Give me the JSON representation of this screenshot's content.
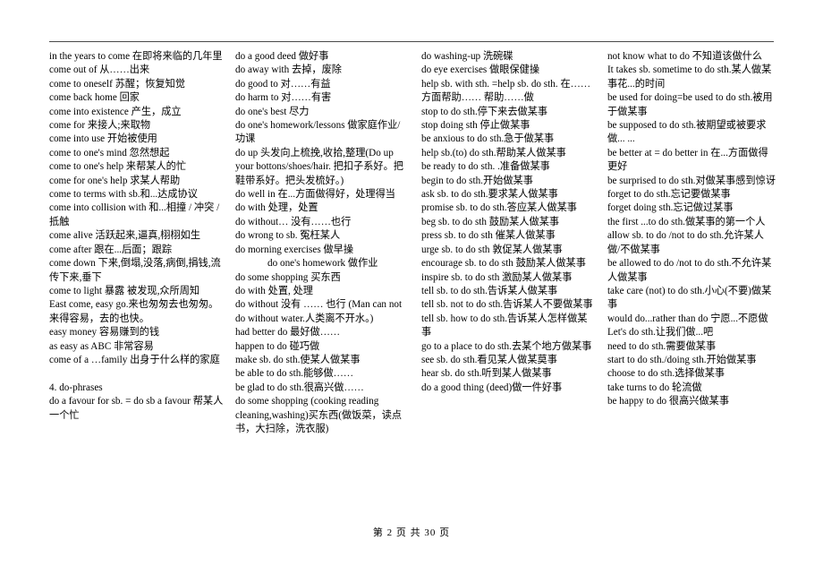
{
  "document": {
    "footer": "第 2 页 共 30 页"
  },
  "columns": [
    {
      "id": "column-1",
      "entries": [
        {
          "text": "in the years to come 在即将来临的几年里",
          "indent": false
        },
        {
          "text": "come out of 从……出来",
          "indent": false
        },
        {
          "text": "come to oneself 苏醒；恢复知觉",
          "indent": false
        },
        {
          "text": "come back home 回家",
          "indent": false
        },
        {
          "text": "come into existence 产生，成立",
          "indent": false
        },
        {
          "text": "come for 来接人;来取物",
          "indent": false
        },
        {
          "text": "come into use 开始被使用",
          "indent": false
        },
        {
          "text": "come to one's mind 忽然想起",
          "indent": false
        },
        {
          "text": "come to one's help 来帮某人的忙",
          "indent": false
        },
        {
          "text": "come for one's help 求某人帮助",
          "indent": false
        },
        {
          "text": "come to terms with sb.和...达成协议",
          "indent": false
        },
        {
          "text": "come into collision with 和...相撞 / 冲突 / 抵触",
          "indent": false
        },
        {
          "text": "come alive 活跃起来,逼真,栩栩如生",
          "indent": false
        },
        {
          "text": "come after 跟在...后面；跟踪",
          "indent": false
        },
        {
          "text": "come down 下来,倒塌,没落,病倒,捐钱,流传下来,垂下",
          "indent": false
        },
        {
          "text": "come to light 暴露 被发现,众所周知",
          "indent": false
        },
        {
          "text": "East come, easy go.来也匆匆去也匆匆。来得容易，去的也快。",
          "indent": false
        },
        {
          "text": "easy money 容易赚到的钱",
          "indent": false
        },
        {
          "text": "as easy as ABC 非常容易",
          "indent": false
        },
        {
          "text": "come of a …family 出身于什么样的家庭",
          "indent": false
        },
        {
          "text": "",
          "indent": false,
          "spacer": true
        },
        {
          "text": "4. do-phrases",
          "indent": false
        },
        {
          "text": "do a favour for sb. = do sb a favour 帮某人一个忙",
          "indent": false
        }
      ]
    },
    {
      "id": "column-2",
      "entries": [
        {
          "text": "do a good deed 做好事",
          "indent": false
        },
        {
          "text": "do away with 去掉，废除",
          "indent": false
        },
        {
          "text": "do good to 对……有益",
          "indent": false
        },
        {
          "text": "do harm to 对……有害",
          "indent": false
        },
        {
          "text": "do one's best 尽力",
          "indent": false
        },
        {
          "text": "do one's homework/lessons 做家庭作业/功课",
          "indent": false
        },
        {
          "text": "do up 头发向上梳挽,收拾,整理(Do up your bottons/shoes/hair. 把扣子系好。把鞋带系好。把头发梳好。)",
          "indent": false
        },
        {
          "text": "do well in 在...方面做得好，处理得当",
          "indent": false
        },
        {
          "text": "do with 处理，处置",
          "indent": false
        },
        {
          "text": "do without… 没有……也行",
          "indent": false
        },
        {
          "text": "do wrong to sb. 冤枉某人",
          "indent": false
        },
        {
          "text": "do morning exercises 做早操",
          "indent": false
        },
        {
          "text": "do one's homework 做作业",
          "indent": true
        },
        {
          "text": "do some shopping 买东西",
          "indent": false
        },
        {
          "text": "do with 处置, 处理",
          "indent": false
        },
        {
          "text": "do without 没有 …… 也行 (Man can not do without water.人类离不开水。)",
          "indent": false
        },
        {
          "text": "had better do 最好做……",
          "indent": false
        },
        {
          "text": "happen to do 碰巧做",
          "indent": false
        },
        {
          "text": "make sb. do sth.使某人做某事",
          "indent": false
        },
        {
          "text": "be able to do sth.能够做……",
          "indent": false
        },
        {
          "text": "be glad to do sth.很高兴做……",
          "indent": false
        },
        {
          "text": "do some shopping (cooking reading cleaning,washing)买东西(做饭菜，读点书，大扫除，洗衣服)",
          "indent": false
        }
      ]
    },
    {
      "id": "column-3",
      "entries": [
        {
          "text": "do washing-up 洗碗碟",
          "indent": false
        },
        {
          "text": "do eye exercises 做眼保健操",
          "indent": false
        },
        {
          "text": "help sb. with sth. =help sb. do sth. 在……方面帮助…… 帮助……做",
          "indent": false
        },
        {
          "text": "stop to do sth.停下来去做某事",
          "indent": false
        },
        {
          "text": "stop doing sth 停止做某事",
          "indent": false
        },
        {
          "text": "be anxious to do sth.急于做某事",
          "indent": false
        },
        {
          "text": "help sb.(to) do sth.帮助某人做某事",
          "indent": false
        },
        {
          "text": "be ready to do sth. .准备做某事",
          "indent": false
        },
        {
          "text": "begin to do sth.开始做某事",
          "indent": false
        },
        {
          "text": "ask sb. to do sth.要求某人做某事",
          "indent": false
        },
        {
          "text": "promise sb. to do sth.答应某人做某事",
          "indent": false
        },
        {
          "text": "beg sb. to do sth 鼓励某人做某事",
          "indent": false
        },
        {
          "text": "press sb. to do sth 催某人做某事",
          "indent": false
        },
        {
          "text": "urge sb. to do sth 敦促某人做某事",
          "indent": false
        },
        {
          "text": "encourage sb. to do sth 鼓励某人做某事",
          "indent": false
        },
        {
          "text": "inspire sb. to do sth 激励某人做某事",
          "indent": false
        },
        {
          "text": "tell sb. to do sth.告诉某人做某事",
          "indent": false
        },
        {
          "text": "tell sb. not to do sth.告诉某人不要做某事",
          "indent": false
        },
        {
          "text": "tell sb. how to do sth.告诉某人怎样做某事",
          "indent": false
        },
        {
          "text": "go to a place to do sth.去某个地方做某事",
          "indent": false
        },
        {
          "text": "see sb. do sth.看见某人做某莫事",
          "indent": false
        },
        {
          "text": "hear sb. do sth.听到某人做某事",
          "indent": false
        },
        {
          "text": "do a good thing (deed)做一件好事",
          "indent": false
        }
      ]
    },
    {
      "id": "column-4",
      "entries": [
        {
          "text": "not know what to do 不知道该做什么",
          "indent": false
        },
        {
          "text": "It takes sb. sometime to do sth.某人做某事花...的时间",
          "indent": false
        },
        {
          "text": "be used for doing=be used to do sth.被用于做某事",
          "indent": false
        },
        {
          "text": "be supposed to do sth.被期望或被要求做... ...",
          "indent": false
        },
        {
          "text": "be better at = do better in 在...方面做得更好",
          "indent": false
        },
        {
          "text": "be surprised to do sth.对做某事感到惊讶",
          "indent": false
        },
        {
          "text": "forget to do sth.忘记要做某事",
          "indent": false
        },
        {
          "text": "forget doing sth.忘记做过某事",
          "indent": false
        },
        {
          "text": "the first ...to do sth.做某事的第一个人",
          "indent": false
        },
        {
          "text": "allow sb. to do /not to do sth.允许某人做/不做某事",
          "indent": false
        },
        {
          "text": "be allowed to do /not to do sth.不允许某人做某事",
          "indent": false
        },
        {
          "text": "take care (not) to do sth.小心(不要)做某事",
          "indent": false
        },
        {
          "text": "would do...rather than do 宁愿...不愿做",
          "indent": false
        },
        {
          "text": "Let's do sth.让我们做...吧",
          "indent": false
        },
        {
          "text": "need to do sth.需要做某事",
          "indent": false
        },
        {
          "text": "start to do sth./doing sth.开始做某事",
          "indent": false
        },
        {
          "text": "choose to do sth.选择做某事",
          "indent": false
        },
        {
          "text": "take turns to do 轮流做",
          "indent": false
        },
        {
          "text": "be happy to do 很高兴做某事",
          "indent": false
        }
      ]
    }
  ]
}
